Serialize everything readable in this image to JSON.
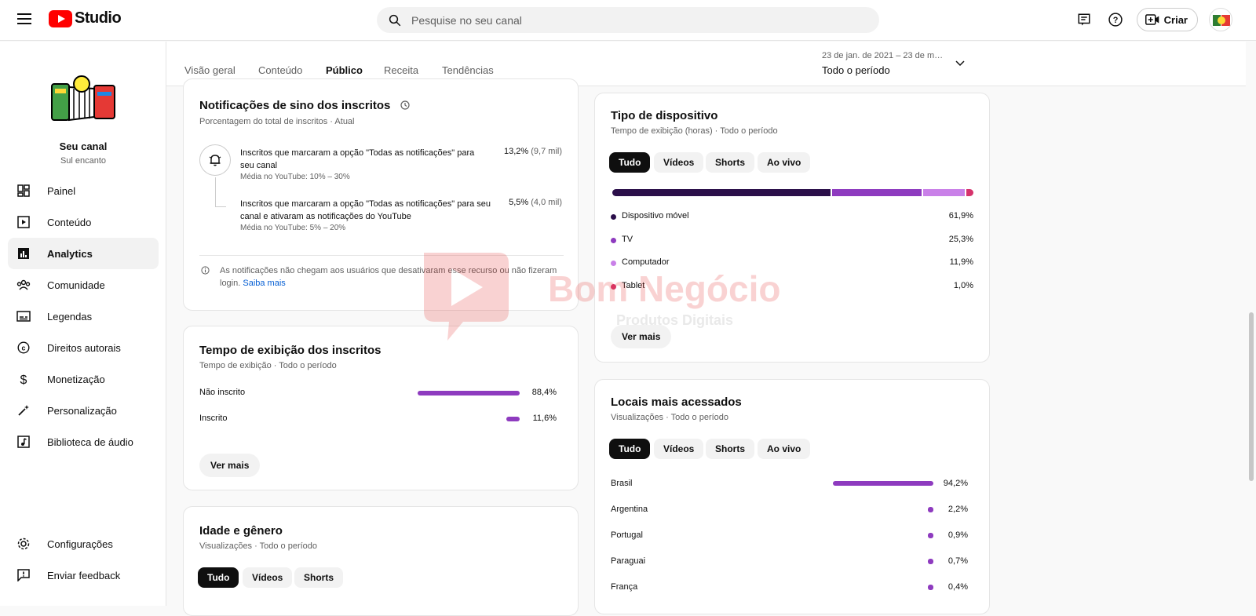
{
  "header": {
    "logo_text": "Studio",
    "search_placeholder": "Pesquise no seu canal",
    "create_label": "Criar"
  },
  "sidebar": {
    "channel_name": "Seu canal",
    "channel_sub": "Sul encanto",
    "items": [
      {
        "label": "Painel",
        "icon": "dashboard-icon"
      },
      {
        "label": "Conteúdo",
        "icon": "content-icon"
      },
      {
        "label": "Analytics",
        "icon": "analytics-icon"
      },
      {
        "label": "Comunidade",
        "icon": "community-icon"
      },
      {
        "label": "Legendas",
        "icon": "subtitles-icon"
      },
      {
        "label": "Direitos autorais",
        "icon": "copyright-icon"
      },
      {
        "label": "Monetização",
        "icon": "dollar-icon"
      },
      {
        "label": "Personalização",
        "icon": "magic-wand-icon"
      },
      {
        "label": "Biblioteca de áudio",
        "icon": "audio-library-icon"
      }
    ],
    "bottom_items": [
      {
        "label": "Configurações",
        "icon": "gear-icon"
      },
      {
        "label": "Enviar feedback",
        "icon": "feedback-icon"
      }
    ]
  },
  "tabs": [
    "Visão geral",
    "Conteúdo",
    "Público",
    "Receita",
    "Tendências"
  ],
  "period": {
    "range": "23 de jan. de 2021 – 23 de mar. ...",
    "label": "Todo o período"
  },
  "bell_card": {
    "title": "Notificações de sino dos inscritos",
    "subtitle": "Porcentagem do total de inscritos · Atual",
    "row1_text": "Inscritos que marcaram a opção \"Todas as notificações\" para seu canal",
    "row1_value": "13,2%",
    "row1_count": "(9,7 mil)",
    "row1_avg": "Média no YouTube: 10% – 30%",
    "row2_text": "Inscritos que marcaram a opção \"Todas as notificações\" para seu canal e ativaram as notificações do YouTube",
    "row2_value": "5,5%",
    "row2_count": "(4,0 mil)",
    "row2_avg": "Média no YouTube: 5% – 20%",
    "note": "As notificações não chegam aos usuários que desativaram esse recurso ou não fizeram login.",
    "note_link": "Saiba mais"
  },
  "watch_card": {
    "title": "Tempo de exibição dos inscritos",
    "subtitle": "Tempo de exibição · Todo o período",
    "rows": [
      {
        "label": "Não inscrito",
        "value": "88,4%",
        "fraction": 0.884
      },
      {
        "label": "Inscrito",
        "value": "11,6%",
        "fraction": 0.116
      }
    ],
    "more_label": "Ver mais"
  },
  "age_card": {
    "title": "Idade e gênero",
    "subtitle": "Visualizações · Todo o período",
    "chips": [
      "Tudo",
      "Vídeos",
      "Shorts"
    ]
  },
  "device_card": {
    "title": "Tipo de dispositivo",
    "subtitle": "Tempo de exibição (horas) · Todo o período",
    "chips": [
      "Tudo",
      "Vídeos",
      "Shorts",
      "Ao vivo"
    ],
    "rows": [
      {
        "label": "Dispositivo móvel",
        "value": "61,9%",
        "fraction": 0.619,
        "color": "#2b0f4a"
      },
      {
        "label": "TV",
        "value": "25,3%",
        "fraction": 0.253,
        "color": "#8e3bbf"
      },
      {
        "label": "Computador",
        "value": "11,9%",
        "fraction": 0.119,
        "color": "#c980e8"
      },
      {
        "label": "Tablet",
        "value": "1,0%",
        "fraction": 0.01,
        "color": "#d6336c"
      }
    ],
    "more_label": "Ver mais"
  },
  "locations_card": {
    "title": "Locais mais acessados",
    "subtitle": "Visualizações · Todo o período",
    "chips": [
      "Tudo",
      "Vídeos",
      "Shorts",
      "Ao vivo"
    ],
    "rows": [
      {
        "label": "Brasil",
        "value": "94,2%",
        "fraction": 0.942
      },
      {
        "label": "Argentina",
        "value": "2,2%",
        "fraction": 0.022
      },
      {
        "label": "Portugal",
        "value": "0,9%",
        "fraction": 0.009
      },
      {
        "label": "Paraguai",
        "value": "0,7%",
        "fraction": 0.007
      },
      {
        "label": "França",
        "value": "0,4%",
        "fraction": 0.004
      }
    ]
  },
  "watermark": {
    "brand": "Bom Negócio",
    "tagline": "Produtos Digitais"
  },
  "colors": {
    "accent": "#8e3bbf",
    "link": "#065fd4"
  }
}
